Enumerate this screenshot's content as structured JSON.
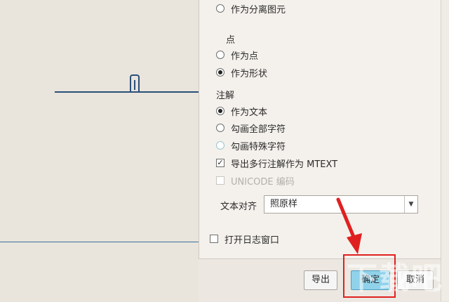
{
  "options": {
    "separate_element": "作为分离图元",
    "points_heading": "点",
    "as_point": "作为点",
    "as_shape": "作为形状",
    "notes_heading": "注解",
    "as_text": "作为文本",
    "outline_all": "勾画全部字符",
    "outline_special": "勾画特殊字符",
    "export_mtext": "导出多行注解作为 MTEXT",
    "unicode": "UNICODE 编码"
  },
  "text_align": {
    "label": "文本对齐",
    "value": "照原样"
  },
  "log_window": "打开日志窗口",
  "buttons": {
    "export": "导出",
    "ok": "确定",
    "cancel": "取消"
  },
  "watermark": "下载吧"
}
